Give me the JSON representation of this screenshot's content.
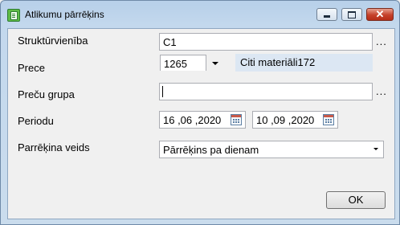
{
  "window": {
    "title": "Atlikumu pārrēķins",
    "icon": "spreadsheet-icon"
  },
  "form": {
    "struktur": {
      "label": "Struktūrvienība",
      "value": "C1",
      "ellipsis": "..."
    },
    "prece": {
      "label": "Prece",
      "value": "1265",
      "description": "Citi materiāli172"
    },
    "grupa": {
      "label": "Preču grupa",
      "value": "",
      "ellipsis": "..."
    },
    "periodu": {
      "label": "Periodu",
      "from": "16 ,06 ,2020",
      "to": "10 ,09 ,2020"
    },
    "veids": {
      "label": "Parrēķina veids",
      "selected": "Pārrēķins pa dienam"
    }
  },
  "buttons": {
    "ok": "OK"
  }
}
